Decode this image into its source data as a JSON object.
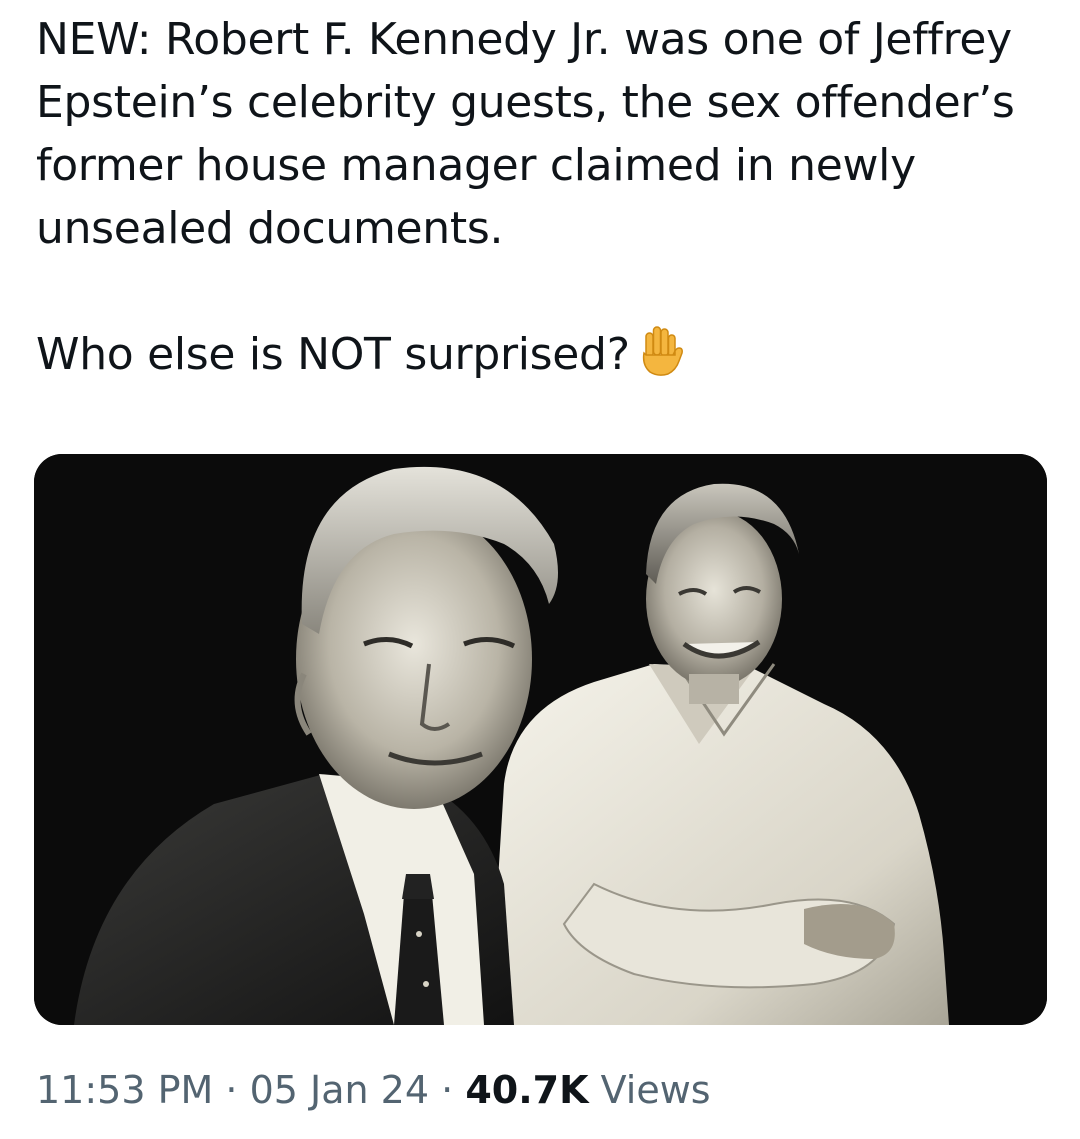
{
  "tweet": {
    "text_line1": "NEW: Robert F. Kennedy Jr. was one of Jeffrey Epstein’s celebrity guests, the sex offender’s former house manager claimed in newly unsealed documents.",
    "text_line2": "Who else is NOT surprised?",
    "emoji_icon": "raised-hand-icon",
    "time": "11:53 PM",
    "separator": "·",
    "date": "05 Jan 24",
    "views_count": "40.7K",
    "views_label": "Views"
  },
  "colors": {
    "text_primary": "#0f1419",
    "text_secondary": "#536471",
    "background": "#ffffff",
    "media_background": "#0b0b0b",
    "emoji": "#f4b63f"
  }
}
